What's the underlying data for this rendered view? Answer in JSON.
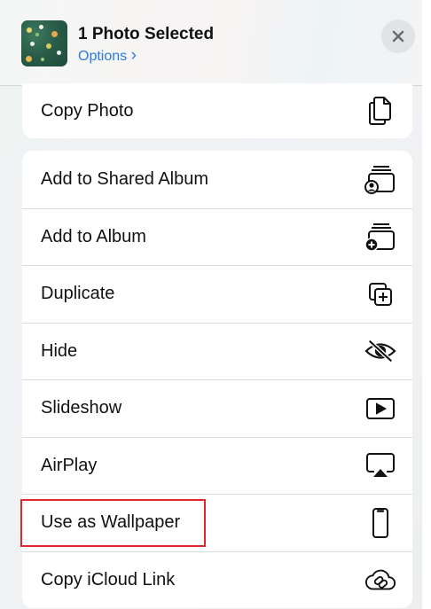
{
  "header": {
    "title": "1 Photo Selected",
    "options_label": "Options",
    "options_chevron": "›",
    "thumbnail_icon": "photo-thumbnail",
    "close_icon": "close-icon"
  },
  "groups": [
    {
      "items": [
        {
          "label": "Copy Photo",
          "icon": "copy-icon"
        }
      ]
    },
    {
      "items": [
        {
          "label": "Add to Shared Album",
          "icon": "shared-album-icon"
        },
        {
          "label": "Add to Album",
          "icon": "add-album-icon"
        },
        {
          "label": "Duplicate",
          "icon": "duplicate-icon"
        },
        {
          "label": "Hide",
          "icon": "eye-slash-icon"
        },
        {
          "label": "Slideshow",
          "icon": "play-icon"
        },
        {
          "label": "AirPlay",
          "icon": "airplay-icon"
        },
        {
          "label": "Use as Wallpaper",
          "icon": "phone-icon"
        },
        {
          "label": "Copy iCloud Link",
          "icon": "cloud-link-icon"
        }
      ]
    }
  ],
  "colors": {
    "accent": "#2a7be0",
    "highlight": "#e0262f",
    "icon": "#111111"
  }
}
